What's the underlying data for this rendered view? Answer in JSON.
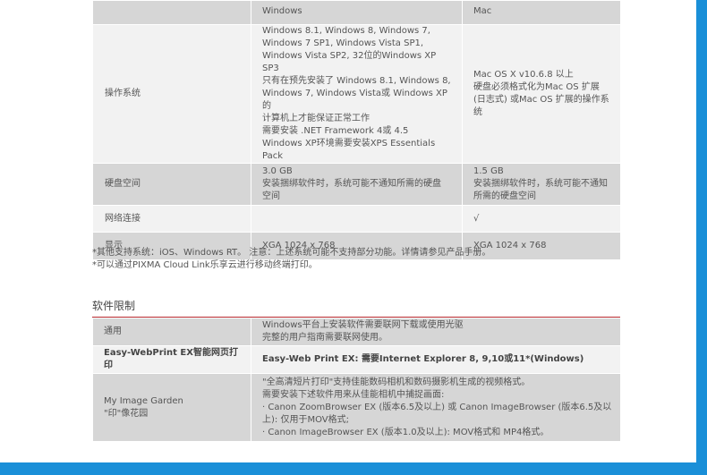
{
  "system_table": {
    "header": {
      "col1": "Windows",
      "col2": "Mac"
    },
    "rows": [
      {
        "label": "操作系统",
        "windows": "Windows 8.1, Windows 8, Windows 7,\nWindows 7 SP1, Windows Vista SP1,\nWindows Vista SP2, 32位的Windows XP SP3\n只有在预先安装了 Windows 8.1, Windows 8,\nWindows 7, Windows Vista或 Windows XP的\n计算机上才能保证正常工作\n需要安装 .NET Framework 4或 4.5\nWindows XP环境需要安装XPS Essentials\nPack",
        "mac": "Mac OS X v10.6.8 以上\n硬盘必须格式化为Mac OS 扩展\n(日志式) 或Mac OS 扩展的操作系\n统"
      },
      {
        "label": "硬盘空间",
        "windows": "3.0 GB\n安装捆绑软件时，系统可能不通知所需的硬盘\n空间",
        "mac": "1.5 GB\n安装捆绑软件时，系统可能不通知\n所需的硬盘空间"
      },
      {
        "label": "网络连接",
        "windows": "",
        "mac": "√"
      },
      {
        "label": "显示",
        "windows": "XGA 1024 x 768",
        "mac": "XGA 1024 x 768"
      }
    ]
  },
  "notes": [
    "*其他支持系统：iOS、Windows RT。 注意：上述系统可能不支持部分功能。详情请参见产品手册。",
    "*可以通过PIXMA Cloud Link乐享云进行移动终端打印。"
  ],
  "software_limits": {
    "title": "软件限制",
    "rows": [
      {
        "label": "通用",
        "desc": "Windows平台上安装软件需要联网下载或使用光驱\n完整的用户指南需要联网使用。"
      },
      {
        "label": "Easy-WebPrint EX智能网页打印",
        "desc": "Easy-Web Print EX: 需要Internet Explorer 8, 9,10或11*(Windows)"
      },
      {
        "label": "My Image Garden\n\"印\"像花园",
        "desc": "\"全高清短片打印\"支持佳能数码相机和数码摄影机生成的视频格式。\n需要安装下述软件用来从佳能相机中捕捉画面:\n· Canon ZoomBrowser EX (版本6.5及以上) 或 Canon ImageBrowser (版本6.5及以\n上): 仅用于MOV格式;\n· Canon ImageBrowser EX (版本1.0及以上): MOV格式和 MP4格式。"
      }
    ]
  }
}
